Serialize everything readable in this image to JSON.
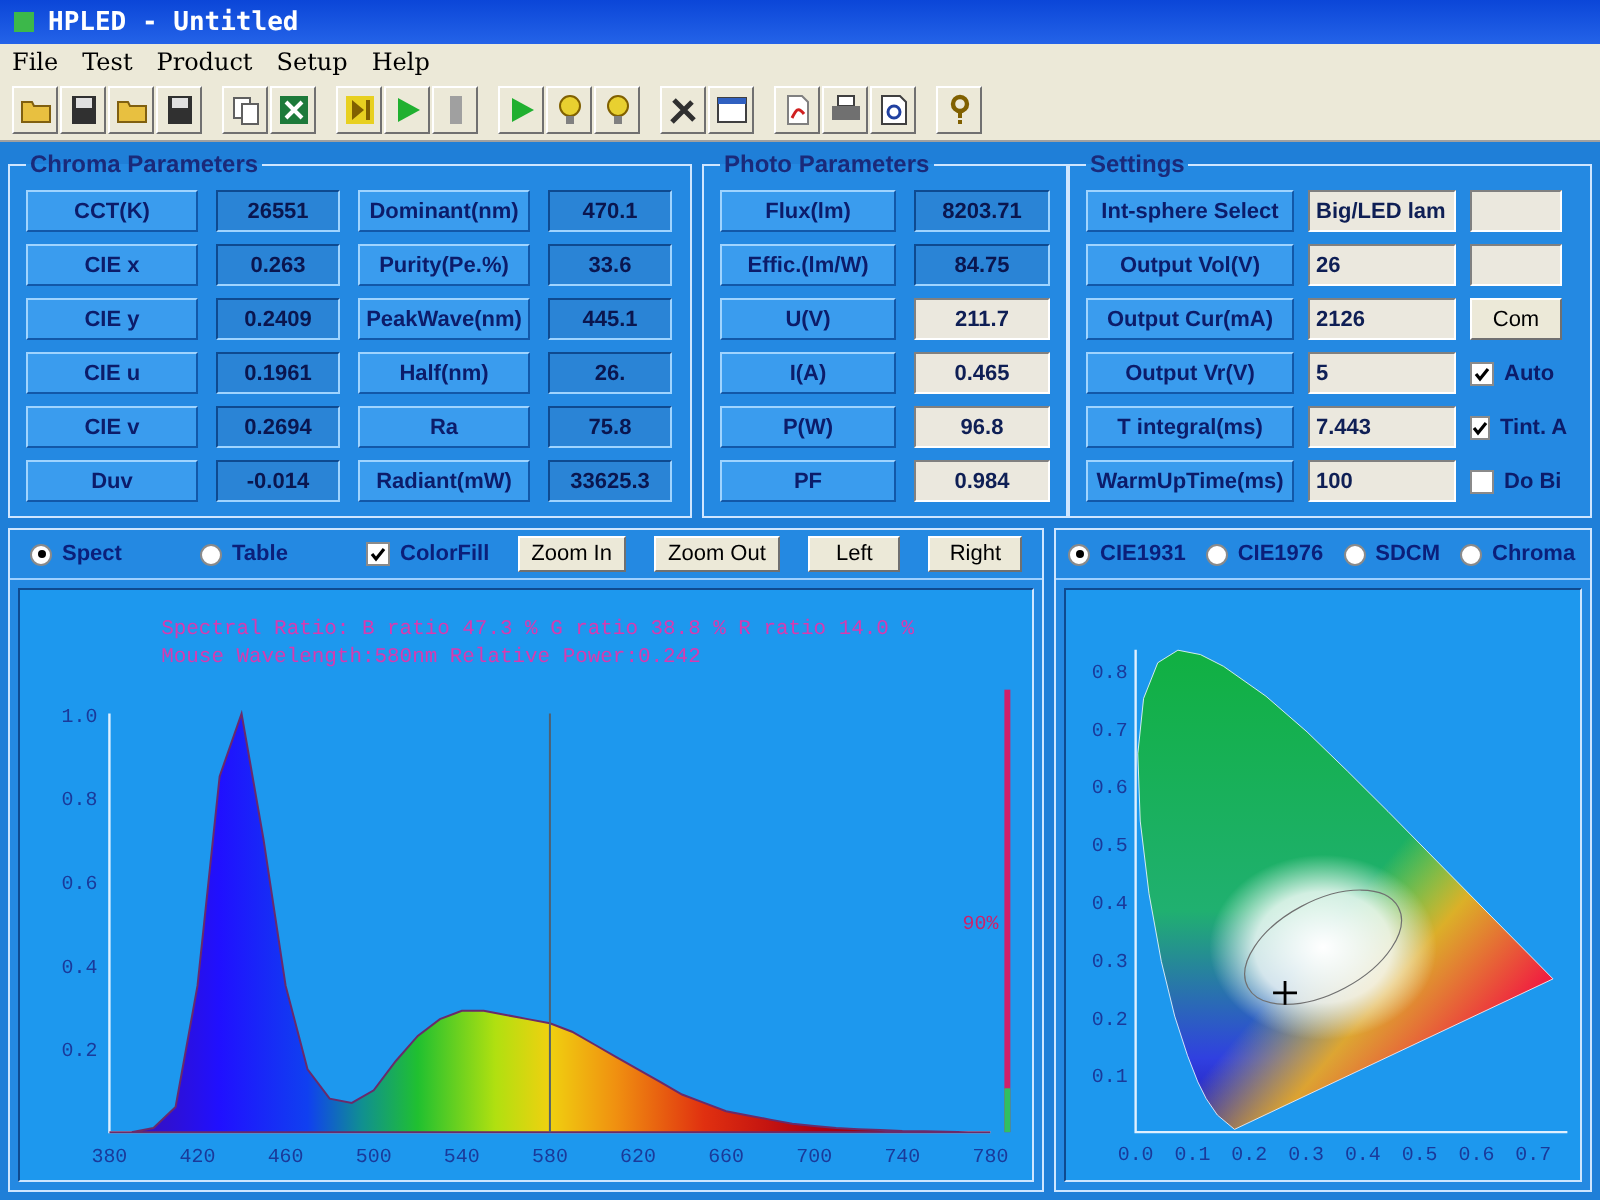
{
  "window": {
    "title": "HPLED - Untitled"
  },
  "menu": [
    "File",
    "Test",
    "Product",
    "Setup",
    "Help"
  ],
  "chroma_parameters": {
    "title": "Chroma Parameters",
    "fields": [
      {
        "label": "CCT(K)",
        "value": "26551",
        "kind": "readout"
      },
      {
        "label": "Dominant(nm)",
        "value": "470.1",
        "kind": "readout"
      },
      {
        "label": "CIE x",
        "value": "0.263",
        "kind": "readout"
      },
      {
        "label": "Purity(Pe.%)",
        "value": "33.6",
        "kind": "readout"
      },
      {
        "label": "CIE y",
        "value": "0.2409",
        "kind": "readout"
      },
      {
        "label": "PeakWave(nm)",
        "value": "445.1",
        "kind": "readout"
      },
      {
        "label": "CIE u",
        "value": "0.1961",
        "kind": "readout"
      },
      {
        "label": "Half(nm)",
        "value": "26.",
        "kind": "readout"
      },
      {
        "label": "CIE v",
        "value": "0.2694",
        "kind": "readout"
      },
      {
        "label": "Ra",
        "value": "75.8",
        "kind": "readout"
      },
      {
        "label": "Duv",
        "value": "-0.014",
        "kind": "readout"
      },
      {
        "label": "Radiant(mW)",
        "value": "33625.3",
        "kind": "readout"
      }
    ]
  },
  "photo_parameters": {
    "title": "Photo Parameters",
    "fields": [
      {
        "label": "Flux(lm)",
        "value": "8203.71",
        "kind": "readout"
      },
      {
        "label": "Effic.(lm/W)",
        "value": "84.75",
        "kind": "readout"
      },
      {
        "label": "U(V)",
        "value": "211.7",
        "kind": "field"
      },
      {
        "label": "I(A)",
        "value": "0.465",
        "kind": "field"
      },
      {
        "label": "P(W)",
        "value": "96.8",
        "kind": "field"
      },
      {
        "label": "PF",
        "value": "0.984",
        "kind": "field"
      }
    ]
  },
  "settings": {
    "title": "Settings",
    "rows": [
      {
        "label": "Int-sphere Select",
        "value": "Big/LED lam",
        "kind": "dropdown"
      },
      {
        "label": "Output Vol(V)",
        "value": "26",
        "kind": "field"
      },
      {
        "label": "Output Cur(mA)",
        "value": "2126",
        "kind": "field"
      },
      {
        "label": "Output Vr(V)",
        "value": "5",
        "kind": "field"
      },
      {
        "label": "T integral(ms)",
        "value": "7.443",
        "kind": "field"
      },
      {
        "label": "WarmUpTime(ms)",
        "value": "100",
        "kind": "field"
      }
    ],
    "extras": [
      {
        "kind": "field"
      },
      {
        "kind": "field"
      },
      {
        "kind": "button",
        "label": "Com"
      },
      {
        "kind": "checkbox",
        "label": "Auto",
        "checked": true
      },
      {
        "kind": "checkbox",
        "label": "Tint. A",
        "checked": true
      },
      {
        "kind": "checkbox",
        "label": "Do Bi",
        "checked": false
      }
    ]
  },
  "spectrum": {
    "views": [
      {
        "label": "Spect",
        "selected": true
      },
      {
        "label": "Table",
        "selected": false
      }
    ],
    "color_fill": {
      "label": "ColorFill",
      "checked": true
    },
    "buttons": [
      "Zoom In",
      "Zoom Out",
      "Left",
      "Right"
    ],
    "info": [
      "Spectral Ratio: B ratio 47.3 %  G ratio 38.8 %  R ratio 14.0 %",
      "Mouse Wavelength:580nm Relative Power:0.242"
    ],
    "meter_reading": "90%",
    "chart_data": {
      "type": "area",
      "x": [
        380,
        390,
        400,
        410,
        420,
        430,
        440,
        450,
        460,
        470,
        480,
        490,
        500,
        510,
        520,
        530,
        540,
        550,
        560,
        570,
        580,
        590,
        600,
        610,
        620,
        630,
        640,
        650,
        660,
        670,
        680,
        690,
        700,
        710,
        720,
        730,
        740,
        750,
        760,
        770,
        780
      ],
      "series": [
        {
          "values": [
            0,
            0,
            0.01,
            0.06,
            0.35,
            0.85,
            1.0,
            0.7,
            0.35,
            0.15,
            0.08,
            0.07,
            0.1,
            0.17,
            0.23,
            0.27,
            0.29,
            0.29,
            0.28,
            0.27,
            0.26,
            0.24,
            0.21,
            0.18,
            0.15,
            0.12,
            0.09,
            0.07,
            0.05,
            0.04,
            0.03,
            0.02,
            0.015,
            0.01,
            0.007,
            0.005,
            0.003,
            0.002,
            0.001,
            0,
            0
          ]
        }
      ],
      "xlim": [
        380,
        780
      ],
      "ylim": [
        0,
        1
      ],
      "xticks": [
        380,
        420,
        460,
        500,
        540,
        580,
        620,
        660,
        700,
        740,
        780
      ],
      "yticks": [
        0.2,
        0.4,
        0.6,
        0.8,
        {
          "value": 1,
          "label": "1.0"
        }
      ],
      "ref_lines": [
        {
          "axis": "x",
          "value": 580
        }
      ]
    }
  },
  "cie": {
    "modes": [
      {
        "label": "CIE1931",
        "selected": true
      },
      {
        "label": "CIE1976",
        "selected": false
      },
      {
        "label": "SDCM",
        "selected": false
      },
      {
        "label": "Chroma",
        "selected": false
      }
    ],
    "y_ticks": [
      "0.8",
      "0.7",
      "0.6",
      "0.5",
      "0.4",
      "0.3",
      "0.2",
      "0.1"
    ],
    "x_ticks": [
      "0.0",
      "0.1",
      "0.2",
      "0.3",
      "0.4",
      "0.5",
      "0.6",
      "0.7"
    ]
  }
}
